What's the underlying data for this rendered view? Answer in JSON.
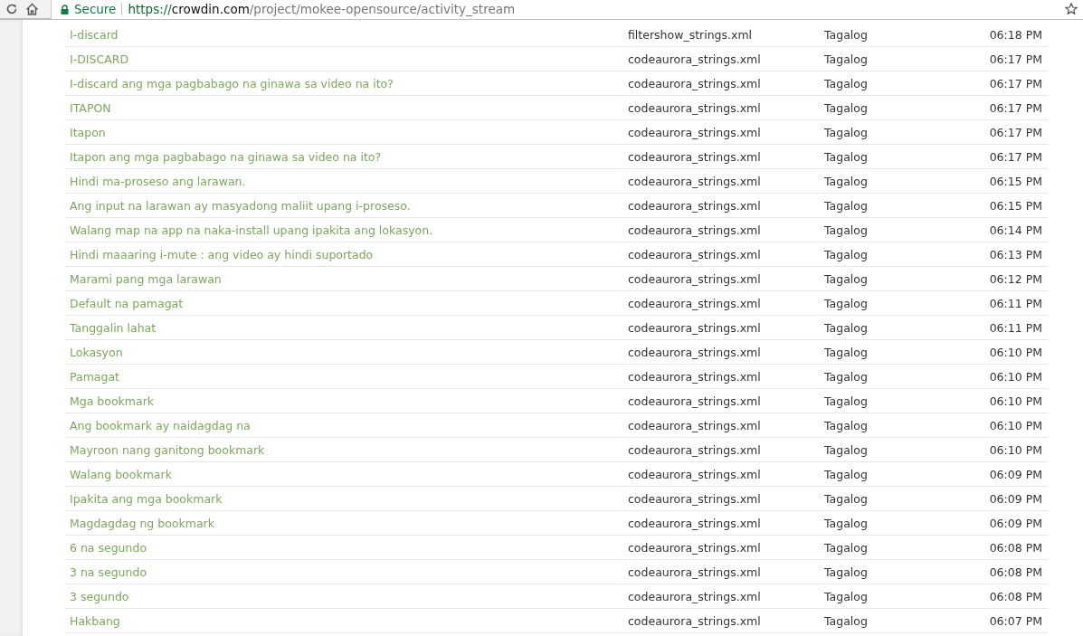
{
  "browser": {
    "secure_label": "Secure",
    "url": {
      "scheme": "https://",
      "host": "crowdin.com",
      "path": "/project/mokee-opensource/activity_stream"
    }
  },
  "activity": [
    {
      "text": "I-discard",
      "file": "filtershow_strings.xml",
      "language": "Tagalog",
      "time": "06:18 PM"
    },
    {
      "text": "I-DISCARD",
      "file": "codeaurora_strings.xml",
      "language": "Tagalog",
      "time": "06:17 PM"
    },
    {
      "text": "I-discard ang mga pagbabago na ginawa sa video na ito?",
      "file": "codeaurora_strings.xml",
      "language": "Tagalog",
      "time": "06:17 PM"
    },
    {
      "text": "ITAPON",
      "file": "codeaurora_strings.xml",
      "language": "Tagalog",
      "time": "06:17 PM"
    },
    {
      "text": "Itapon",
      "file": "codeaurora_strings.xml",
      "language": "Tagalog",
      "time": "06:17 PM"
    },
    {
      "text": "Itapon ang mga pagbabago na ginawa sa video na ito?",
      "file": "codeaurora_strings.xml",
      "language": "Tagalog",
      "time": "06:17 PM"
    },
    {
      "text": "Hindi ma-proseso ang larawan.",
      "file": "codeaurora_strings.xml",
      "language": "Tagalog",
      "time": "06:15 PM"
    },
    {
      "text": "Ang input na larawan ay masyadong maliit upang i-proseso.",
      "file": "codeaurora_strings.xml",
      "language": "Tagalog",
      "time": "06:15 PM"
    },
    {
      "text": "Walang map na app na naka-install upang ipakita ang lokasyon.",
      "file": "codeaurora_strings.xml",
      "language": "Tagalog",
      "time": "06:14 PM"
    },
    {
      "text": "Hindi maaaring i-mute : ang video ay hindi suportado",
      "file": "codeaurora_strings.xml",
      "language": "Tagalog",
      "time": "06:13 PM"
    },
    {
      "text": "Marami pang mga larawan",
      "file": "codeaurora_strings.xml",
      "language": "Tagalog",
      "time": "06:12 PM"
    },
    {
      "text": "Default na pamagat",
      "file": "codeaurora_strings.xml",
      "language": "Tagalog",
      "time": "06:11 PM"
    },
    {
      "text": "Tanggalin lahat",
      "file": "codeaurora_strings.xml",
      "language": "Tagalog",
      "time": "06:11 PM"
    },
    {
      "text": "Lokasyon",
      "file": "codeaurora_strings.xml",
      "language": "Tagalog",
      "time": "06:10 PM"
    },
    {
      "text": "Pamagat",
      "file": "codeaurora_strings.xml",
      "language": "Tagalog",
      "time": "06:10 PM"
    },
    {
      "text": "Mga bookmark",
      "file": "codeaurora_strings.xml",
      "language": "Tagalog",
      "time": "06:10 PM"
    },
    {
      "text": "Ang bookmark ay naidagdag na",
      "file": "codeaurora_strings.xml",
      "language": "Tagalog",
      "time": "06:10 PM"
    },
    {
      "text": "Mayroon nang ganitong bookmark",
      "file": "codeaurora_strings.xml",
      "language": "Tagalog",
      "time": "06:10 PM"
    },
    {
      "text": "Walang bookmark",
      "file": "codeaurora_strings.xml",
      "language": "Tagalog",
      "time": "06:09 PM"
    },
    {
      "text": "Ipakita ang mga bookmark",
      "file": "codeaurora_strings.xml",
      "language": "Tagalog",
      "time": "06:09 PM"
    },
    {
      "text": "Magdagdag ng bookmark",
      "file": "codeaurora_strings.xml",
      "language": "Tagalog",
      "time": "06:09 PM"
    },
    {
      "text": "6 na segundo",
      "file": "codeaurora_strings.xml",
      "language": "Tagalog",
      "time": "06:08 PM"
    },
    {
      "text": "3 na segundo",
      "file": "codeaurora_strings.xml",
      "language": "Tagalog",
      "time": "06:08 PM"
    },
    {
      "text": "3 segundo",
      "file": "codeaurora_strings.xml",
      "language": "Tagalog",
      "time": "06:08 PM"
    },
    {
      "text": "Hakbang",
      "file": "codeaurora_strings.xml",
      "language": "Tagalog",
      "time": "06:07 PM"
    }
  ]
}
